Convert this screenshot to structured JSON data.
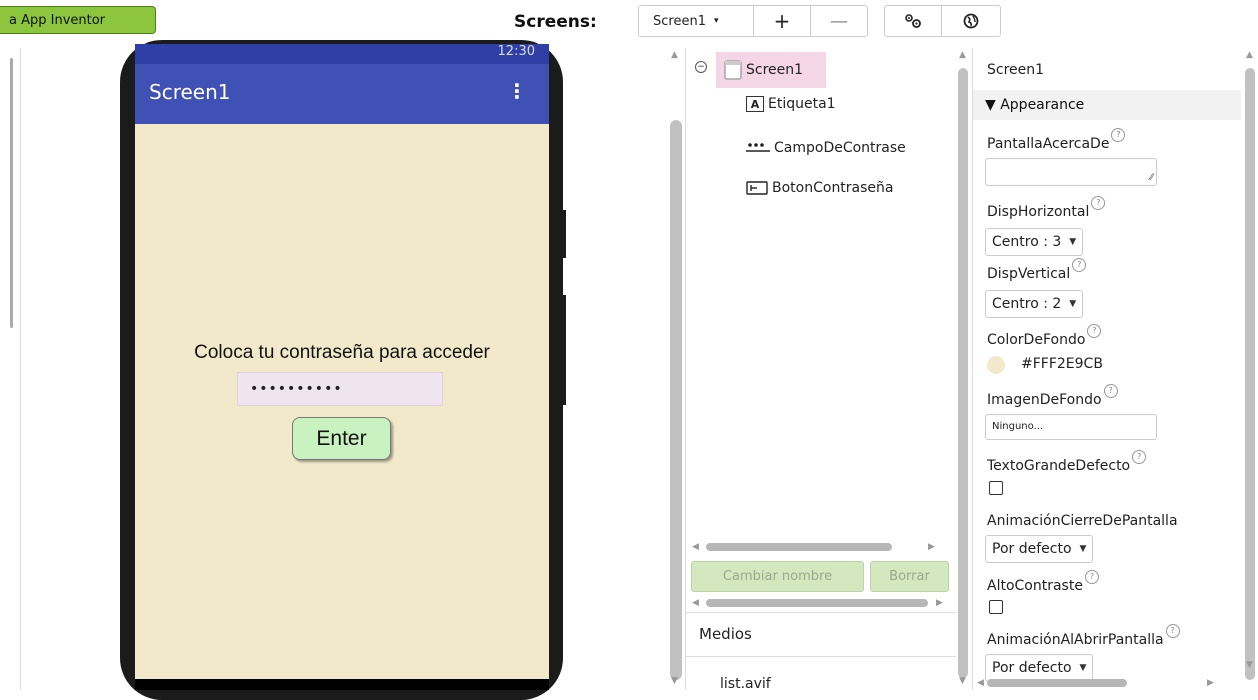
{
  "toolbar": {
    "app_button": "a App Inventor",
    "screens_label": "Screens:",
    "screen_select": "Screen1",
    "add_label": "+",
    "remove_label": "—"
  },
  "phone": {
    "status_time": "12:30",
    "title": "Screen1",
    "menu": "⋮",
    "label_text": "Coloca tu contraseña para acceder",
    "password_value": "••••••••••",
    "button_text": "Enter",
    "background_color": "#F2E9CB",
    "appbar_color": "#3F51B5"
  },
  "tree": {
    "root": "Screen1",
    "children": [
      {
        "label": "Etiqueta1",
        "icon": "label-icon"
      },
      {
        "label": "CampoDeContrase",
        "icon": "password-textbox-icon"
      },
      {
        "label": "BotonContraseña",
        "icon": "button-icon"
      }
    ],
    "rename_button": "Cambiar nombre",
    "delete_button": "Borrar"
  },
  "media": {
    "title": "Medios",
    "files": [
      "list.avif"
    ]
  },
  "properties": {
    "component": "Screen1",
    "section": "▼ Appearance",
    "about_label": "PantallaAcercaDe",
    "align_h_label": "DispHorizontal",
    "align_h_value": "Centro : 3",
    "align_v_label": "DispVertical",
    "align_v_value": "Centro : 2",
    "bg_color_label": "ColorDeFondo",
    "bg_color_value": "#FFF2E9CB",
    "bg_image_label": "ImagenDeFondo",
    "bg_image_value": "Ninguno...",
    "big_text_label": "TextoGrandeDefecto",
    "close_anim_label": "AnimaciónCierreDePantalla",
    "close_anim_value": "Por defecto",
    "high_contrast_label": "AltoContraste",
    "open_anim_label": "AnimaciónAlAbrirPantalla",
    "open_anim_value": "Por defecto"
  }
}
